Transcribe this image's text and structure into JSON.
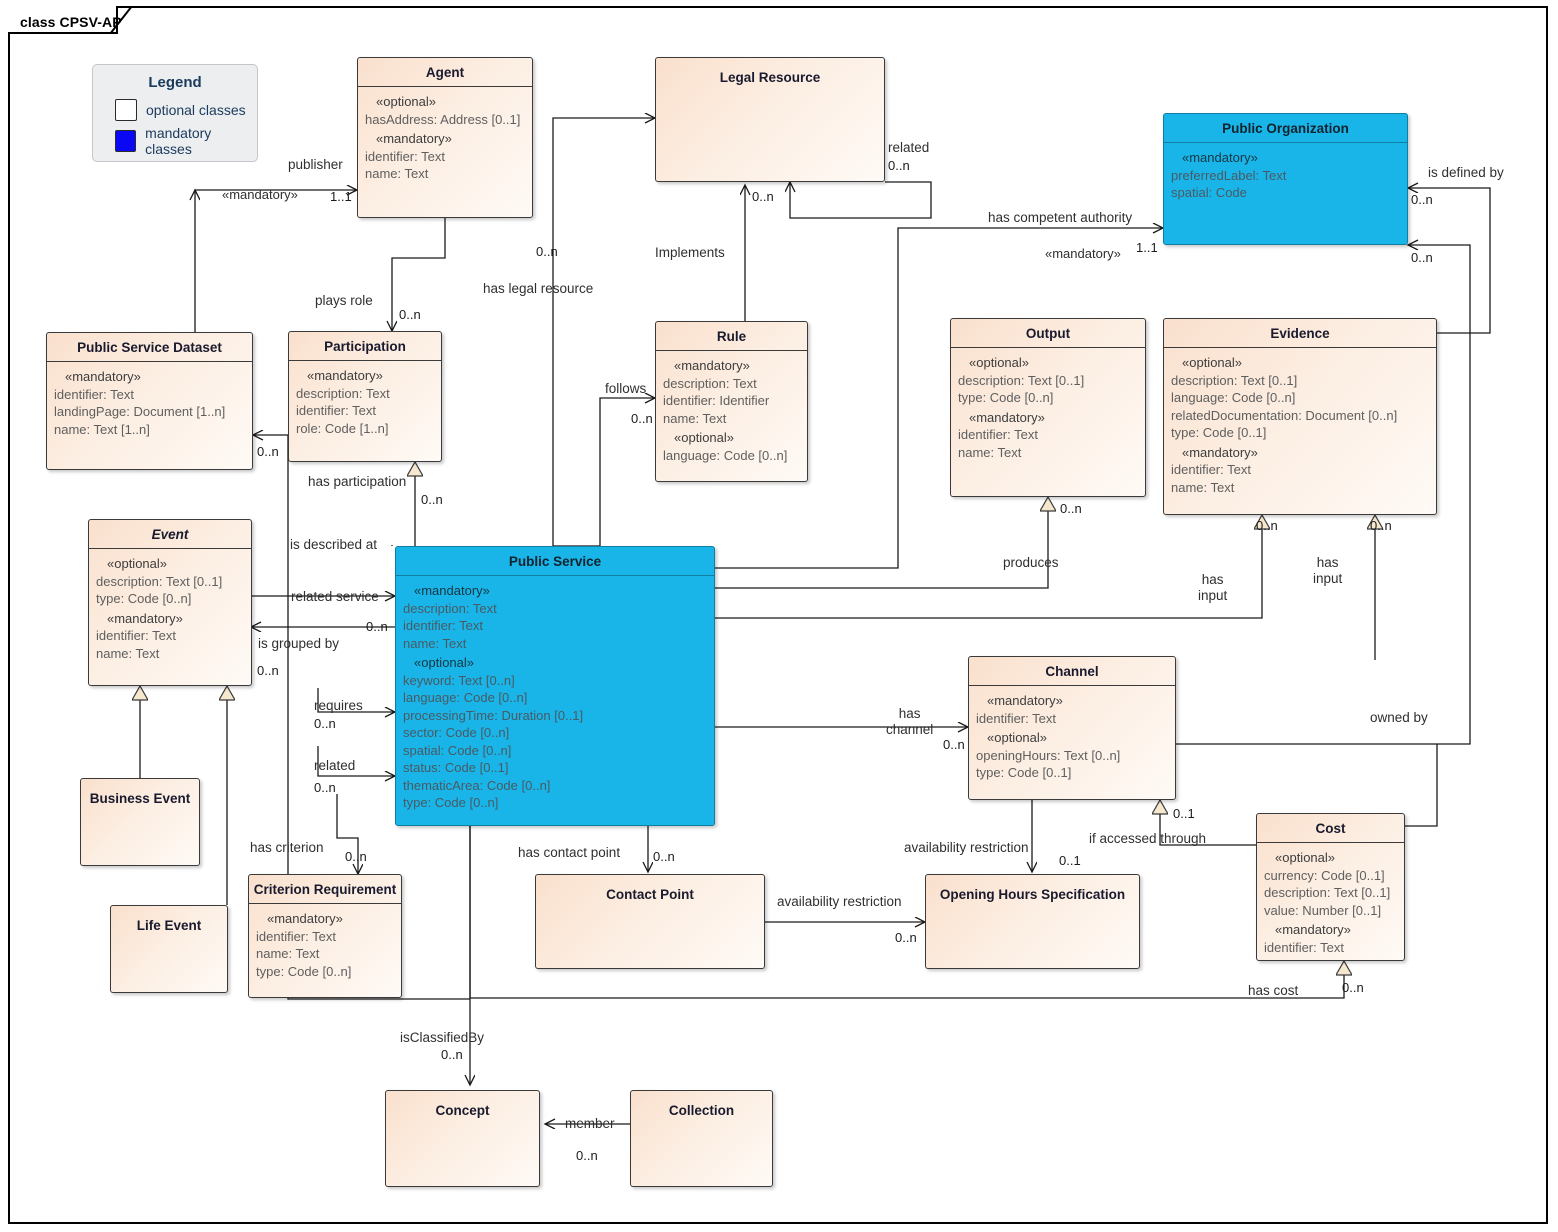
{
  "frame": {
    "tab_label": "class CPSV-AP"
  },
  "legend": {
    "title": "Legend",
    "items": [
      {
        "label": "optional classes",
        "color": "#ffffff"
      },
      {
        "label": "mandatory classes",
        "color": "#0a07f5"
      }
    ]
  },
  "colors": {
    "optional_fill": "#fae0cd",
    "mandatory_fill": "#19b5e8",
    "border": "#3a3a3a"
  },
  "classes": [
    {
      "id": "agent",
      "name": "Agent",
      "kind": "optional",
      "italic": false,
      "groups": [
        {
          "stereotype": "«optional»",
          "attrs": [
            "hasAddress: Address [0..1]"
          ]
        },
        {
          "stereotype": "«mandatory»",
          "attrs": [
            "identifier: Text",
            "name: Text"
          ]
        }
      ]
    },
    {
      "id": "legal-resource",
      "name": "Legal Resource",
      "kind": "optional",
      "italic": false,
      "groups": []
    },
    {
      "id": "public-organization",
      "name": "Public Organization",
      "kind": "mandatory",
      "italic": false,
      "groups": [
        {
          "stereotype": "«mandatory»",
          "attrs": [
            "preferredLabel: Text",
            "spatial: Code"
          ]
        }
      ]
    },
    {
      "id": "public-service-dataset",
      "name": "Public Service Dataset",
      "kind": "optional",
      "italic": false,
      "groups": [
        {
          "stereotype": "«mandatory»",
          "attrs": [
            "identifier: Text",
            "landingPage: Document [1..n]",
            "name: Text [1..n]"
          ]
        }
      ]
    },
    {
      "id": "participation",
      "name": "Participation",
      "kind": "optional",
      "italic": false,
      "groups": [
        {
          "stereotype": "«mandatory»",
          "attrs": [
            "description: Text",
            "identifier: Text",
            "role: Code [1..n]"
          ]
        }
      ]
    },
    {
      "id": "rule",
      "name": "Rule",
      "kind": "optional",
      "italic": false,
      "groups": [
        {
          "stereotype": "«mandatory»",
          "attrs": [
            "description: Text",
            "identifier: Identifier",
            "name: Text"
          ]
        },
        {
          "stereotype": "«optional»",
          "attrs": [
            "language: Code [0..n]"
          ]
        }
      ]
    },
    {
      "id": "output",
      "name": "Output",
      "kind": "optional",
      "italic": false,
      "groups": [
        {
          "stereotype": "«optional»",
          "attrs": [
            "description: Text [0..1]",
            "type: Code [0..n]"
          ]
        },
        {
          "stereotype": "«mandatory»",
          "attrs": [
            "identifier: Text",
            "name: Text"
          ]
        }
      ]
    },
    {
      "id": "evidence",
      "name": "Evidence",
      "kind": "optional",
      "italic": false,
      "groups": [
        {
          "stereotype": "«optional»",
          "attrs": [
            "description: Text [0..1]",
            "language: Code [0..n]",
            "relatedDocumentation: Document [0..n]",
            "type: Code [0..1]"
          ]
        },
        {
          "stereotype": "«mandatory»",
          "attrs": [
            "identifier: Text",
            "name: Text"
          ]
        }
      ]
    },
    {
      "id": "event",
      "name": "Event",
      "kind": "optional",
      "italic": true,
      "groups": [
        {
          "stereotype": "«optional»",
          "attrs": [
            "description: Text [0..1]",
            "type: Code [0..n]"
          ]
        },
        {
          "stereotype": "«mandatory»",
          "attrs": [
            "identifier: Text",
            "name: Text"
          ]
        }
      ]
    },
    {
      "id": "public-service",
      "name": "Public Service",
      "kind": "mandatory",
      "italic": false,
      "groups": [
        {
          "stereotype": "«mandatory»",
          "attrs": [
            "description: Text",
            "identifier: Text",
            "name: Text"
          ]
        },
        {
          "stereotype": "«optional»",
          "attrs": [
            "keyword: Text [0..n]",
            "language: Code [0..n]",
            "processingTime: Duration [0..1]",
            "sector: Code [0..n]",
            "spatial: Code [0..n]",
            "status: Code [0..1]",
            "thematicArea: Code [0..n]",
            "type: Code [0..n]"
          ]
        }
      ]
    },
    {
      "id": "business-event",
      "name": "Business Event",
      "kind": "optional",
      "italic": false,
      "groups": []
    },
    {
      "id": "life-event",
      "name": "Life Event",
      "kind": "optional",
      "italic": false,
      "groups": []
    },
    {
      "id": "criterion-requirement",
      "name": "Criterion Requirement",
      "kind": "optional",
      "italic": false,
      "groups": [
        {
          "stereotype": "«mandatory»",
          "attrs": [
            "identifier: Text",
            "name: Text",
            "type: Code [0..n]"
          ]
        }
      ]
    },
    {
      "id": "channel",
      "name": "Channel",
      "kind": "optional",
      "italic": false,
      "groups": [
        {
          "stereotype": "«mandatory»",
          "attrs": [
            "identifier: Text"
          ]
        },
        {
          "stereotype": "«optional»",
          "attrs": [
            "openingHours: Text [0..n]",
            "type: Code [0..1]"
          ]
        }
      ]
    },
    {
      "id": "cost",
      "name": "Cost",
      "kind": "optional",
      "italic": false,
      "groups": [
        {
          "stereotype": "«optional»",
          "attrs": [
            "currency: Code [0..1]",
            "description: Text [0..1]",
            "value: Number [0..1]"
          ]
        },
        {
          "stereotype": "«mandatory»",
          "attrs": [
            "identifier: Text"
          ]
        }
      ]
    },
    {
      "id": "contact-point",
      "name": "Contact Point",
      "kind": "optional",
      "italic": false,
      "groups": []
    },
    {
      "id": "opening-hours-specification",
      "name": "Opening Hours Specification",
      "kind": "optional",
      "italic": false,
      "groups": []
    },
    {
      "id": "concept",
      "name": "Concept",
      "kind": "optional",
      "italic": false,
      "groups": []
    },
    {
      "id": "collection",
      "name": "Collection",
      "kind": "optional",
      "italic": false,
      "groups": []
    }
  ],
  "edge_labels": {
    "publisher": "publisher",
    "publisher_stereotype": "«mandatory»",
    "publisher_mult": "1..1",
    "plays_role": "plays role",
    "plays_role_mult": "0..n",
    "has_legal_resource": "has legal resource",
    "has_legal_resource_mult": "0..n",
    "implements": "Implements",
    "implements_mult": "0..n",
    "related_legalresource": "related",
    "related_legalresource_mult": "0..n",
    "follows": "follows",
    "follows_mult": "0..n",
    "has_competent_authority": "has competent authority",
    "has_competent_authority_stereotype": "«mandatory»",
    "has_competent_authority_mult": "1..1",
    "is_defined_by": "is defined by",
    "is_defined_by_mult": "0..n",
    "owned_by": "owned by",
    "owned_by_mult": "0..n",
    "psd_mult": "0..n",
    "has_participation": "has participation",
    "has_participation_mult": "0..n",
    "is_described_at": "is described at",
    "produces": "produces",
    "produces_mult": "0..n",
    "has_input_evidence": "has\ninput",
    "has_input_evidence_mult": "0..n",
    "has_input_evidence2_mult": "0..n",
    "related_service": "related service",
    "related_service_mult": "0..n",
    "is_grouped_by": "is grouped by",
    "is_grouped_by_mult": "0..n",
    "requires": "requires",
    "requires_mult": "0..n",
    "related_service2": "related",
    "related_service2_mult": "0..n",
    "has_criterion": "has criterion",
    "has_criterion_mult": "0..n",
    "has_channel": "has\nchannel",
    "has_channel_mult": "0..n",
    "has_contact_point": "has contact point",
    "has_contact_point_mult": "0..n",
    "availability_restriction_cp": "availability restriction",
    "availability_restriction_cp_mult": "0..n",
    "availability_restriction_ch": "availability restriction",
    "availability_restriction_ch_mult": "0..1",
    "if_accessed_through": "if accessed through",
    "if_accessed_through_mult": "0..1",
    "has_cost": "has cost",
    "has_cost_mult": "0..n",
    "is_classified_by": "isClassifiedBy",
    "is_classified_by_mult": "0..n",
    "member": "member",
    "member_mult": "0..n"
  }
}
